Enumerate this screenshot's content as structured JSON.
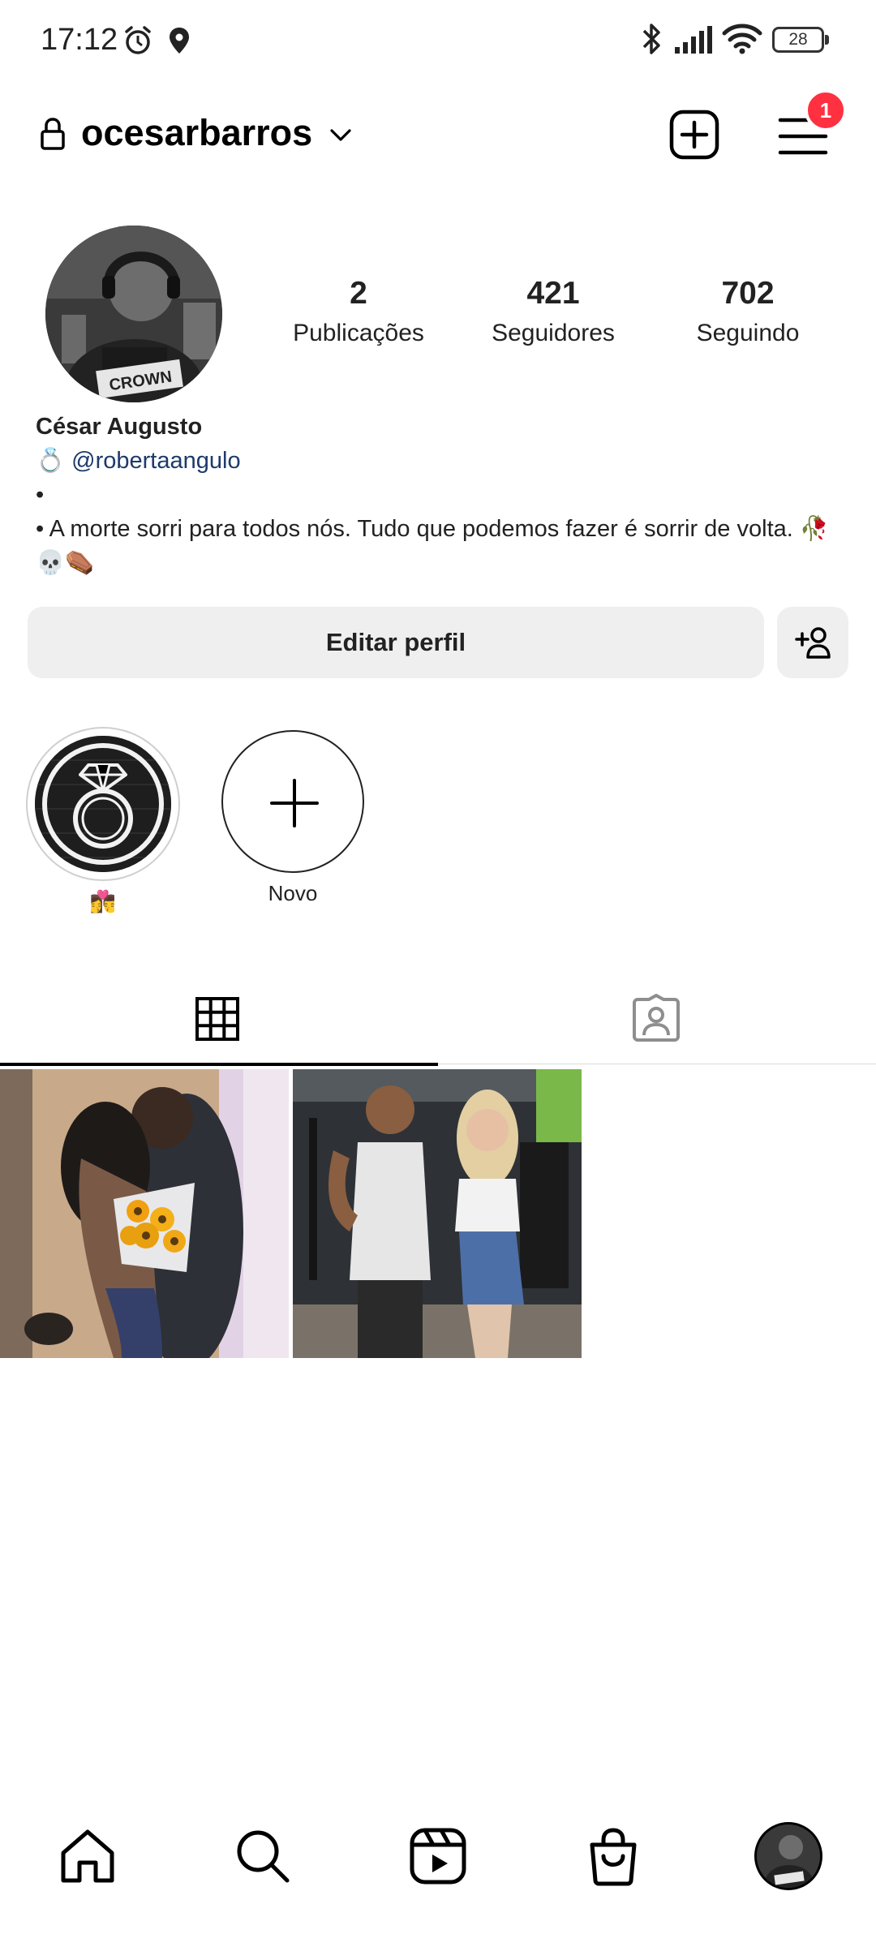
{
  "status_bar": {
    "time": "17:12",
    "battery": "28",
    "icons": [
      "alarm-icon",
      "location-icon",
      "bluetooth-icon",
      "signal-icon",
      "wifi-icon",
      "battery-icon"
    ]
  },
  "header": {
    "username": "ocesarbarros",
    "notification_count": "1"
  },
  "stats": [
    {
      "value": "2",
      "label": "Publicações"
    },
    {
      "value": "421",
      "label": "Seguidores"
    },
    {
      "value": "702",
      "label": "Seguindo"
    }
  ],
  "bio": {
    "name": "César Augusto",
    "link_prefix": "💍",
    "link": "@robertaangulo",
    "line1": "•",
    "line2": "• A morte sorri para todos nós. Tudo que podemos fazer é sorrir de volta. 🥀💀⚰️"
  },
  "buttons": {
    "edit_profile": "Editar perfil"
  },
  "highlights": [
    {
      "label": "👩‍❤️‍💋‍👨"
    },
    {
      "label": "Novo"
    }
  ],
  "tabs": [
    "posts-grid-tab",
    "tagged-tab"
  ],
  "colors": {
    "badge": "#ff3040",
    "button_bg": "#efefef",
    "link": "#1d3a6b"
  }
}
